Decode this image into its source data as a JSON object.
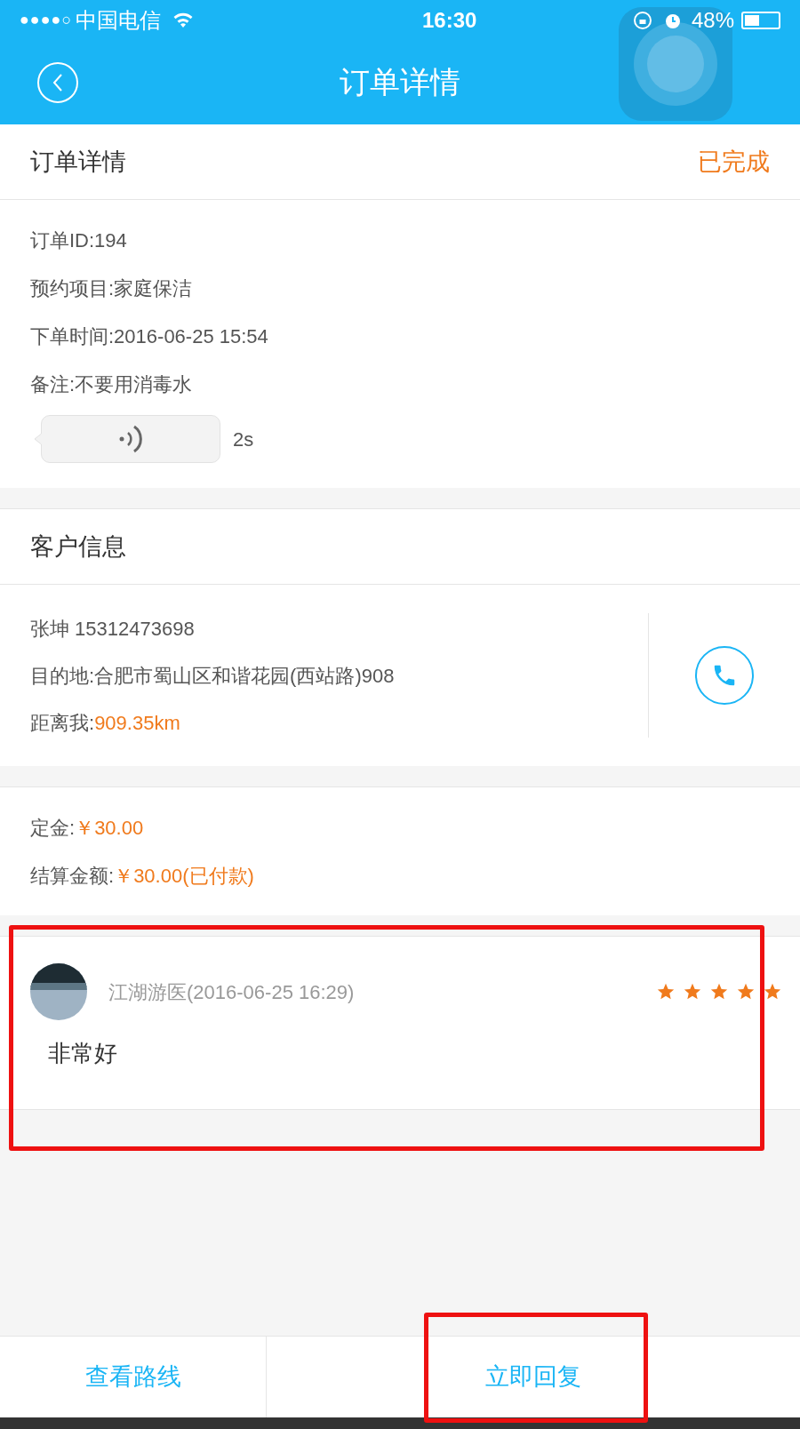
{
  "status_bar": {
    "signal": "●●●●○",
    "carrier": "中国电信",
    "time": "16:30",
    "battery": "48%"
  },
  "nav": {
    "title": "订单详情"
  },
  "order": {
    "title": "订单详情",
    "status": "已完成",
    "lines": [
      "订单ID:194",
      "预约项目:家庭保洁",
      "下单时间:2016-06-25 15:54",
      "备注:不要用消毒水"
    ],
    "voice_duration": "2s"
  },
  "customer": {
    "title": "客户信息",
    "name_phone": "张坤 15312473698",
    "destination": "目的地:合肥市蜀山区和谐花园(西站路)908",
    "distance_label": "距离我:",
    "distance": "909.35km"
  },
  "payment": [
    {
      "label": "定金:",
      "value": "￥30.00"
    },
    {
      "label": "结算金额:",
      "value": "￥30.00(已付款)"
    }
  ],
  "review": {
    "author": "江湖游医(2016-06-25 16:29)",
    "stars": 5,
    "text": "非常好"
  },
  "bottom_bar": [
    "查看路线",
    "立即回复"
  ]
}
